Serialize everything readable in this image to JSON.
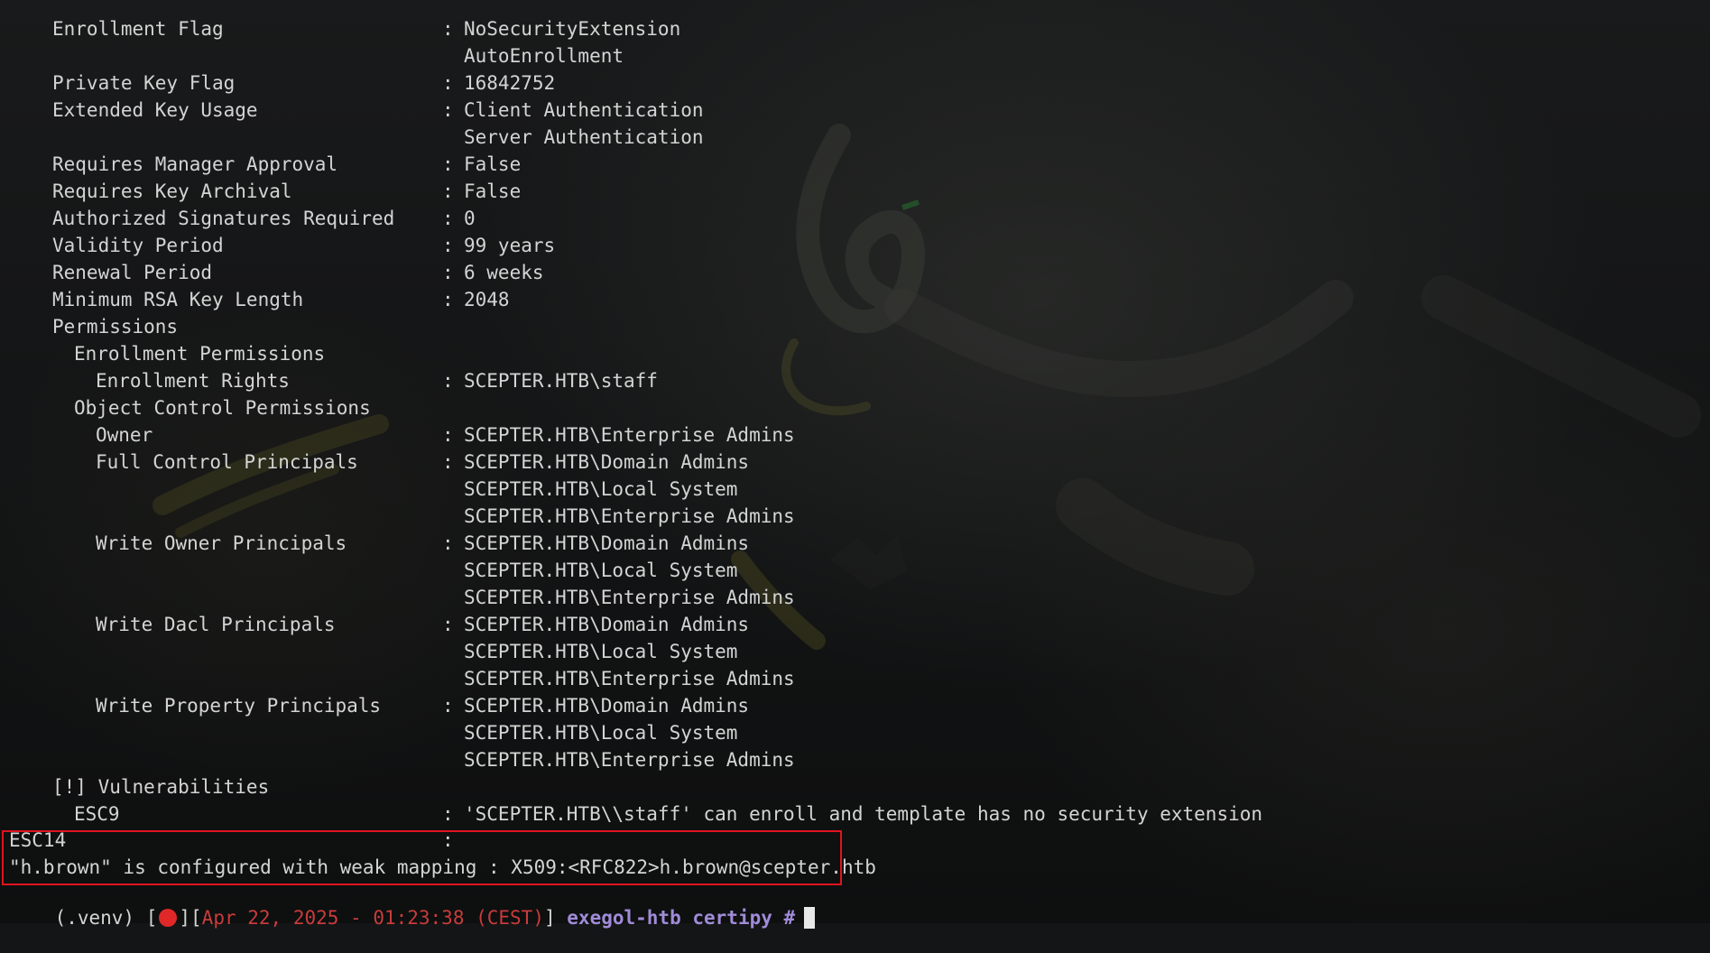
{
  "terminal": {
    "rows": [
      {
        "label": "Enrollment Flag",
        "values": [
          "NoSecurityExtension",
          "AutoEnrollment"
        ],
        "indent": 0
      },
      {
        "label": "Private Key Flag",
        "values": [
          "16842752"
        ],
        "indent": 0
      },
      {
        "label": "Extended Key Usage",
        "values": [
          "Client Authentication",
          "Server Authentication"
        ],
        "indent": 0
      },
      {
        "label": "Requires Manager Approval",
        "values": [
          "False"
        ],
        "indent": 0
      },
      {
        "label": "Requires Key Archival",
        "values": [
          "False"
        ],
        "indent": 0
      },
      {
        "label": "Authorized Signatures Required",
        "values": [
          "0"
        ],
        "indent": 0
      },
      {
        "label": "Validity Period",
        "values": [
          "99 years"
        ],
        "indent": 0
      },
      {
        "label": "Renewal Period",
        "values": [
          "6 weeks"
        ],
        "indent": 0
      },
      {
        "label": "Minimum RSA Key Length",
        "values": [
          "2048"
        ],
        "indent": 0
      },
      {
        "label": "Permissions",
        "values": [],
        "indent": 0
      },
      {
        "label": "Enrollment Permissions",
        "values": [],
        "indent": 1
      },
      {
        "label": "Enrollment Rights",
        "values": [
          "SCEPTER.HTB\\staff"
        ],
        "indent": 2
      },
      {
        "label": "Object Control Permissions",
        "values": [],
        "indent": 1
      },
      {
        "label": "Owner",
        "values": [
          "SCEPTER.HTB\\Enterprise Admins"
        ],
        "indent": 2
      },
      {
        "label": "Full Control Principals",
        "values": [
          "SCEPTER.HTB\\Domain Admins",
          "SCEPTER.HTB\\Local System",
          "SCEPTER.HTB\\Enterprise Admins"
        ],
        "indent": 2
      },
      {
        "label": "Write Owner Principals",
        "values": [
          "SCEPTER.HTB\\Domain Admins",
          "SCEPTER.HTB\\Local System",
          "SCEPTER.HTB\\Enterprise Admins"
        ],
        "indent": 2
      },
      {
        "label": "Write Dacl Principals",
        "values": [
          "SCEPTER.HTB\\Domain Admins",
          "SCEPTER.HTB\\Local System",
          "SCEPTER.HTB\\Enterprise Admins"
        ],
        "indent": 2
      },
      {
        "label": "Write Property Principals",
        "values": [
          "SCEPTER.HTB\\Domain Admins",
          "SCEPTER.HTB\\Local System",
          "SCEPTER.HTB\\Enterprise Admins"
        ],
        "indent": 2
      },
      {
        "label": "[!] Vulnerabilities",
        "values": [],
        "indent": 0
      },
      {
        "label": "ESC9",
        "values": [
          "'SCEPTER.HTB\\\\staff' can enroll and template has no security extension"
        ],
        "indent": 1
      }
    ],
    "highlight": {
      "esc14_label": "ESC14",
      "esc14_colon": ":",
      "mapping_line": "\"h.brown\" is configured with weak mapping : X509:<RFC822>h.brown@scepter.htb"
    },
    "prompt": {
      "venv": "(.venv) [",
      "bracket_mid": "][",
      "datetime": "Apr 22, 2025 - 01:23:38 (CEST)",
      "bracket_end": "]",
      "host": "exegol-htb",
      "cwd": "certipy",
      "symbol": "#"
    },
    "colors": {
      "text": "#d4d4d4",
      "highlight_border": "#e0141e",
      "prompt_red": "#c83c3c",
      "prompt_purple": "#a08bd8",
      "record_dot": "#e02828"
    }
  }
}
